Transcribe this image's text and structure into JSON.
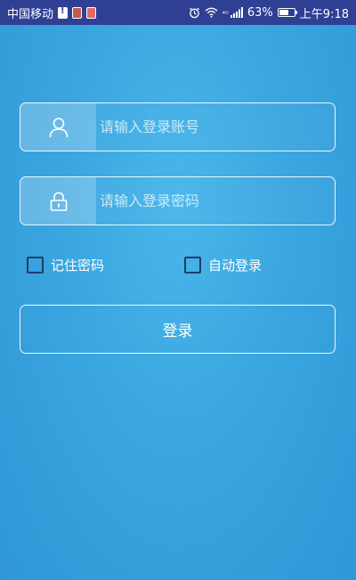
{
  "status_bar": {
    "carrier": "中国移动",
    "signal_label": "⁴ᴳ",
    "battery": "63%",
    "battery_level": 0.63,
    "time": "上午9:18"
  },
  "login": {
    "username_placeholder": "请输入登录账号",
    "password_placeholder": "请输入登录密码",
    "remember_label": "记住密码",
    "auto_login_label": "自动登录",
    "submit_label": "登录"
  }
}
